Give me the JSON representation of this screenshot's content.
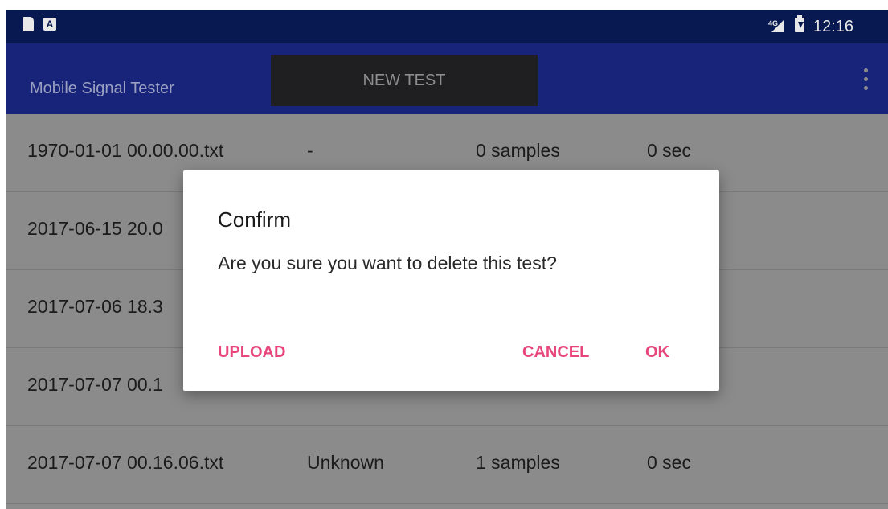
{
  "status_bar": {
    "network_label": "4G",
    "time": "12:16",
    "icons": [
      "sd-card-icon",
      "a-notification-icon",
      "cell-signal-icon",
      "battery-charging-icon"
    ]
  },
  "app_bar": {
    "title": "Mobile Signal Tester",
    "new_test_label": "NEW TEST",
    "menu_icon": "overflow-menu-icon"
  },
  "tests": [
    {
      "name": "1970-01-01 00.00.00.txt",
      "type": "-",
      "samples": "0 samples",
      "duration": "0 sec"
    },
    {
      "name": "2017-06-15 20.0",
      "type": "",
      "samples": "",
      "duration": ""
    },
    {
      "name": "2017-07-06 18.3",
      "type": "",
      "samples": "",
      "duration": ""
    },
    {
      "name": "2017-07-07 00.1",
      "type": "",
      "samples": "",
      "duration": ""
    },
    {
      "name": "2017-07-07 00.16.06.txt",
      "type": "Unknown",
      "samples": "1 samples",
      "duration": "0 sec"
    }
  ],
  "dialog": {
    "title": "Confirm",
    "message": "Are you sure you want to delete this test?",
    "upload_label": "UPLOAD",
    "cancel_label": "CANCEL",
    "ok_label": "OK"
  },
  "colors": {
    "status_bar": "#081850",
    "app_bar": "#18237a",
    "dim_overlay_bg": "#8b8b8b",
    "accent": "#e8457c"
  }
}
